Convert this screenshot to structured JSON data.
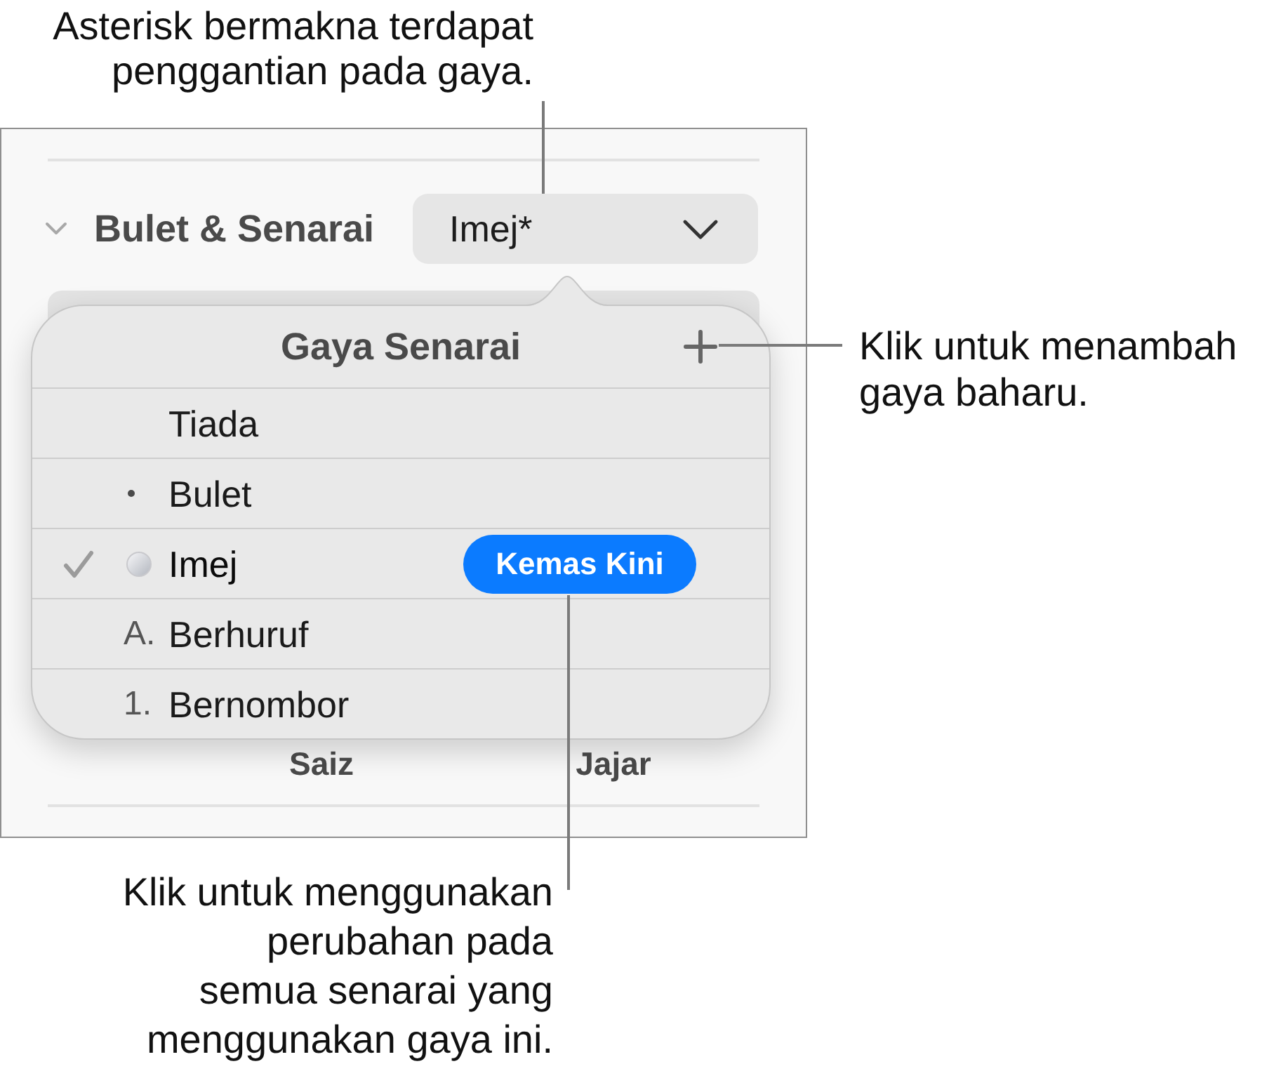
{
  "callouts": [
    {
      "text": "Asterisk bermakna terdapat\npenggantian pada gaya."
    },
    {
      "text": "Klik untuk menambah\ngaya baharu."
    },
    {
      "text": "Klik untuk menggunakan\nperubahan pada\nsemua senarai yang\nmenggunakan gaya ini."
    }
  ],
  "panel": {
    "section": {
      "title": "Bulet & Senarai",
      "expanded": true
    },
    "style_popup": {
      "value": "Imej*"
    },
    "labels": [
      "Saiz",
      "Jajar"
    ]
  },
  "popover": {
    "title": "Gaya Senarai",
    "items": [
      {
        "kind": "none",
        "label": "Tiada",
        "selected": false
      },
      {
        "kind": "bullet",
        "label": "Bulet",
        "selected": false
      },
      {
        "kind": "image",
        "label": "Imej",
        "selected": true,
        "action": "Kemas Kini"
      },
      {
        "kind": "text",
        "marker": "A.",
        "label": "Berhuruf",
        "selected": false
      },
      {
        "kind": "text",
        "marker": "1.",
        "label": "Bernombor",
        "selected": false
      }
    ]
  }
}
